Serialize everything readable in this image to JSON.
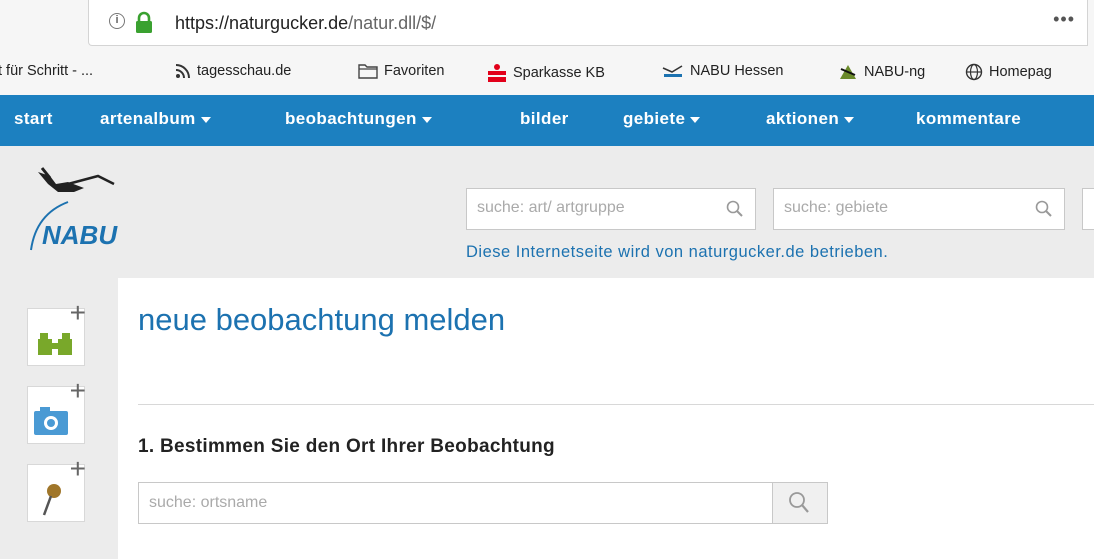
{
  "browser": {
    "url_host": "https://naturgucker.de",
    "url_path": "/natur.dll/$/",
    "menu": "•••",
    "bookmarks": [
      {
        "label": "t für Schritt - ..."
      },
      {
        "label": "tagesschau.de"
      },
      {
        "label": "Favoriten"
      },
      {
        "label": "Sparkasse KB"
      },
      {
        "label": "NABU Hessen"
      },
      {
        "label": "NABU-ng"
      },
      {
        "label": "Homepag"
      }
    ]
  },
  "nav": {
    "items": [
      {
        "label": "start"
      },
      {
        "label": "artenalbum"
      },
      {
        "label": "beobachtungen"
      },
      {
        "label": "bilder"
      },
      {
        "label": "gebiete"
      },
      {
        "label": "aktionen"
      },
      {
        "label": "kommentare"
      }
    ]
  },
  "header": {
    "logo_text": "NABU",
    "search_species_placeholder": "suche: art/ artgruppe",
    "search_areas_placeholder": "suche: gebiete",
    "tagline": "Diese Internetseite wird von naturgucker.de betrieben."
  },
  "sidebar": {
    "items": [
      {
        "icon": "binoculars-plus-icon"
      },
      {
        "icon": "camera-plus-icon"
      },
      {
        "icon": "map-pin-plus-icon"
      }
    ],
    "plus": "+"
  },
  "main": {
    "title": "neue beobachtung melden",
    "step1_heading": "1. Bestimmen Sie den Ort Ihrer Beobachtung",
    "location_placeholder": "suche: ortsname"
  },
  "colors": {
    "nav_bg": "#1c80c0",
    "title_blue": "#1c72b0",
    "band_bg": "#ececec",
    "lock_green": "#3aa130"
  }
}
